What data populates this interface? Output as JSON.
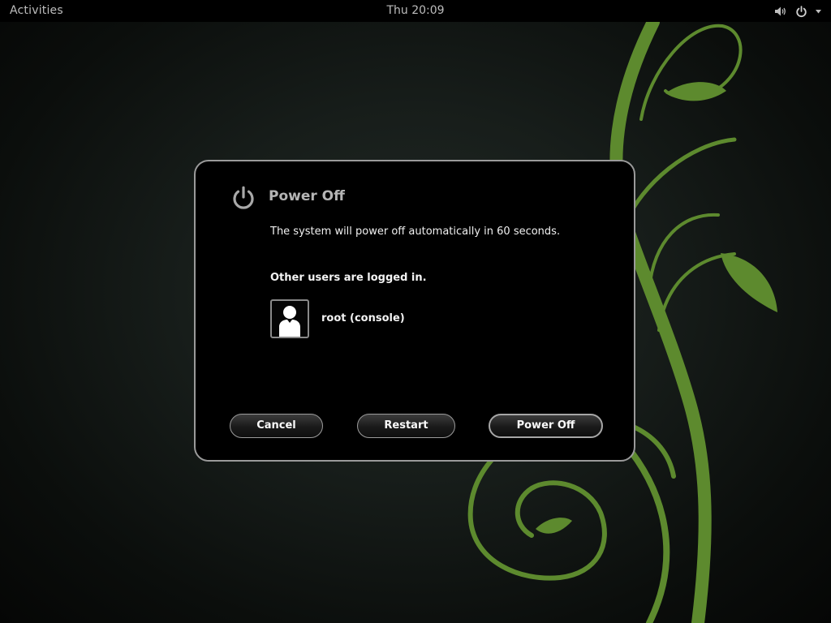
{
  "top_panel": {
    "activities_label": "Activities",
    "clock": "Thu 20:09",
    "volume_icon": "speaker-volume-icon",
    "power_icon": "power-icon",
    "menu_icon": "chevron-down-icon"
  },
  "dialog": {
    "icon": "power-icon",
    "title": "Power Off",
    "description": "The system will power off automatically in 60 seconds.",
    "users_heading": "Other users are logged in.",
    "users": [
      {
        "name": "root (console)",
        "avatar": "user-avatar-icon"
      }
    ],
    "buttons": {
      "cancel": "Cancel",
      "restart": "Restart",
      "power_off": "Power Off"
    }
  },
  "colors": {
    "panel_bg": "#000000",
    "dialog_bg": "#000000",
    "dialog_border": "#9a9a9a",
    "vine_green": "#5d8a2e",
    "desktop_bg": "#171d1a"
  }
}
